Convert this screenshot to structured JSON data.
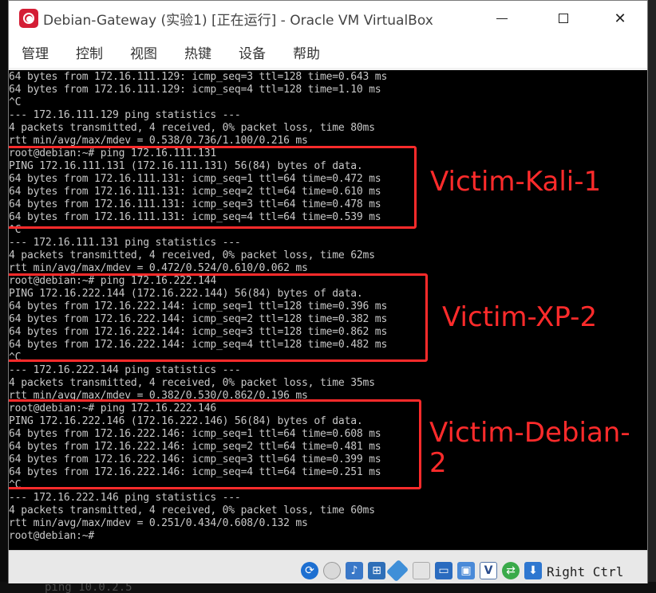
{
  "window": {
    "title": "Debian-Gateway (实验1) [正在运行] - Oracle VM VirtualBox",
    "controls": {
      "minimize": "minimize",
      "maximize": "maximize",
      "close": "✕"
    }
  },
  "menu": [
    "管理",
    "控制",
    "视图",
    "热键",
    "设备",
    "帮助"
  ],
  "terminal": {
    "lines": [
      "64 bytes from 172.16.111.129: icmp_seq=3 ttl=128 time=0.643 ms",
      "64 bytes from 172.16.111.129: icmp_seq=4 ttl=128 time=1.10 ms",
      "^C",
      "--- 172.16.111.129 ping statistics ---",
      "4 packets transmitted, 4 received, 0% packet loss, time 80ms",
      "rtt min/avg/max/mdev = 0.538/0.736/1.100/0.216 ms",
      "root@debian:~# ping 172.16.111.131",
      "PING 172.16.111.131 (172.16.111.131) 56(84) bytes of data.",
      "64 bytes from 172.16.111.131: icmp_seq=1 ttl=64 time=0.472 ms",
      "64 bytes from 172.16.111.131: icmp_seq=2 ttl=64 time=0.610 ms",
      "64 bytes from 172.16.111.131: icmp_seq=3 ttl=64 time=0.478 ms",
      "64 bytes from 172.16.111.131: icmp_seq=4 ttl=64 time=0.539 ms",
      "^C",
      "--- 172.16.111.131 ping statistics ---",
      "4 packets transmitted, 4 received, 0% packet loss, time 62ms",
      "rtt min/avg/max/mdev = 0.472/0.524/0.610/0.062 ms",
      "root@debian:~# ping 172.16.222.144",
      "PING 172.16.222.144 (172.16.222.144) 56(84) bytes of data.",
      "64 bytes from 172.16.222.144: icmp_seq=1 ttl=128 time=0.396 ms",
      "64 bytes from 172.16.222.144: icmp_seq=2 ttl=128 time=0.382 ms",
      "64 bytes from 172.16.222.144: icmp_seq=3 ttl=128 time=0.862 ms",
      "64 bytes from 172.16.222.144: icmp_seq=4 ttl=128 time=0.482 ms",
      "^C",
      "--- 172.16.222.144 ping statistics ---",
      "4 packets transmitted, 4 received, 0% packet loss, time 35ms",
      "rtt min/avg/max/mdev = 0.382/0.530/0.862/0.196 ms",
      "root@debian:~# ping 172.16.222.146",
      "PING 172.16.222.146 (172.16.222.146) 56(84) bytes of data.",
      "64 bytes from 172.16.222.146: icmp_seq=1 ttl=64 time=0.608 ms",
      "64 bytes from 172.16.222.146: icmp_seq=2 ttl=64 time=0.481 ms",
      "64 bytes from 172.16.222.146: icmp_seq=3 ttl=64 time=0.399 ms",
      "64 bytes from 172.16.222.146: icmp_seq=4 ttl=64 time=0.251 ms",
      "^C",
      "--- 172.16.222.146 ping statistics ---",
      "4 packets transmitted, 4 received, 0% packet loss, time 60ms",
      "rtt min/avg/max/mdev = 0.251/0.434/0.608/0.132 ms",
      "root@debian:~#"
    ]
  },
  "annotations": {
    "box1": "Victim-Kali-1",
    "box2": "Victim-XP-2",
    "box3": "Victim-Debian-\n2",
    "color": "#ff2b2b"
  },
  "statusbar": {
    "host_key": "Right Ctrl",
    "icons": [
      "hard-disk-icon",
      "optical-drive-icon",
      "audio-icon",
      "network-icon",
      "usb-icon",
      "shared-folder-icon",
      "display-icon",
      "recording-icon",
      "virtualization-icon",
      "mouse-integration-icon",
      "host-key-icon"
    ]
  },
  "background": {
    "bottom_text": "ping 10.0.2.5"
  }
}
